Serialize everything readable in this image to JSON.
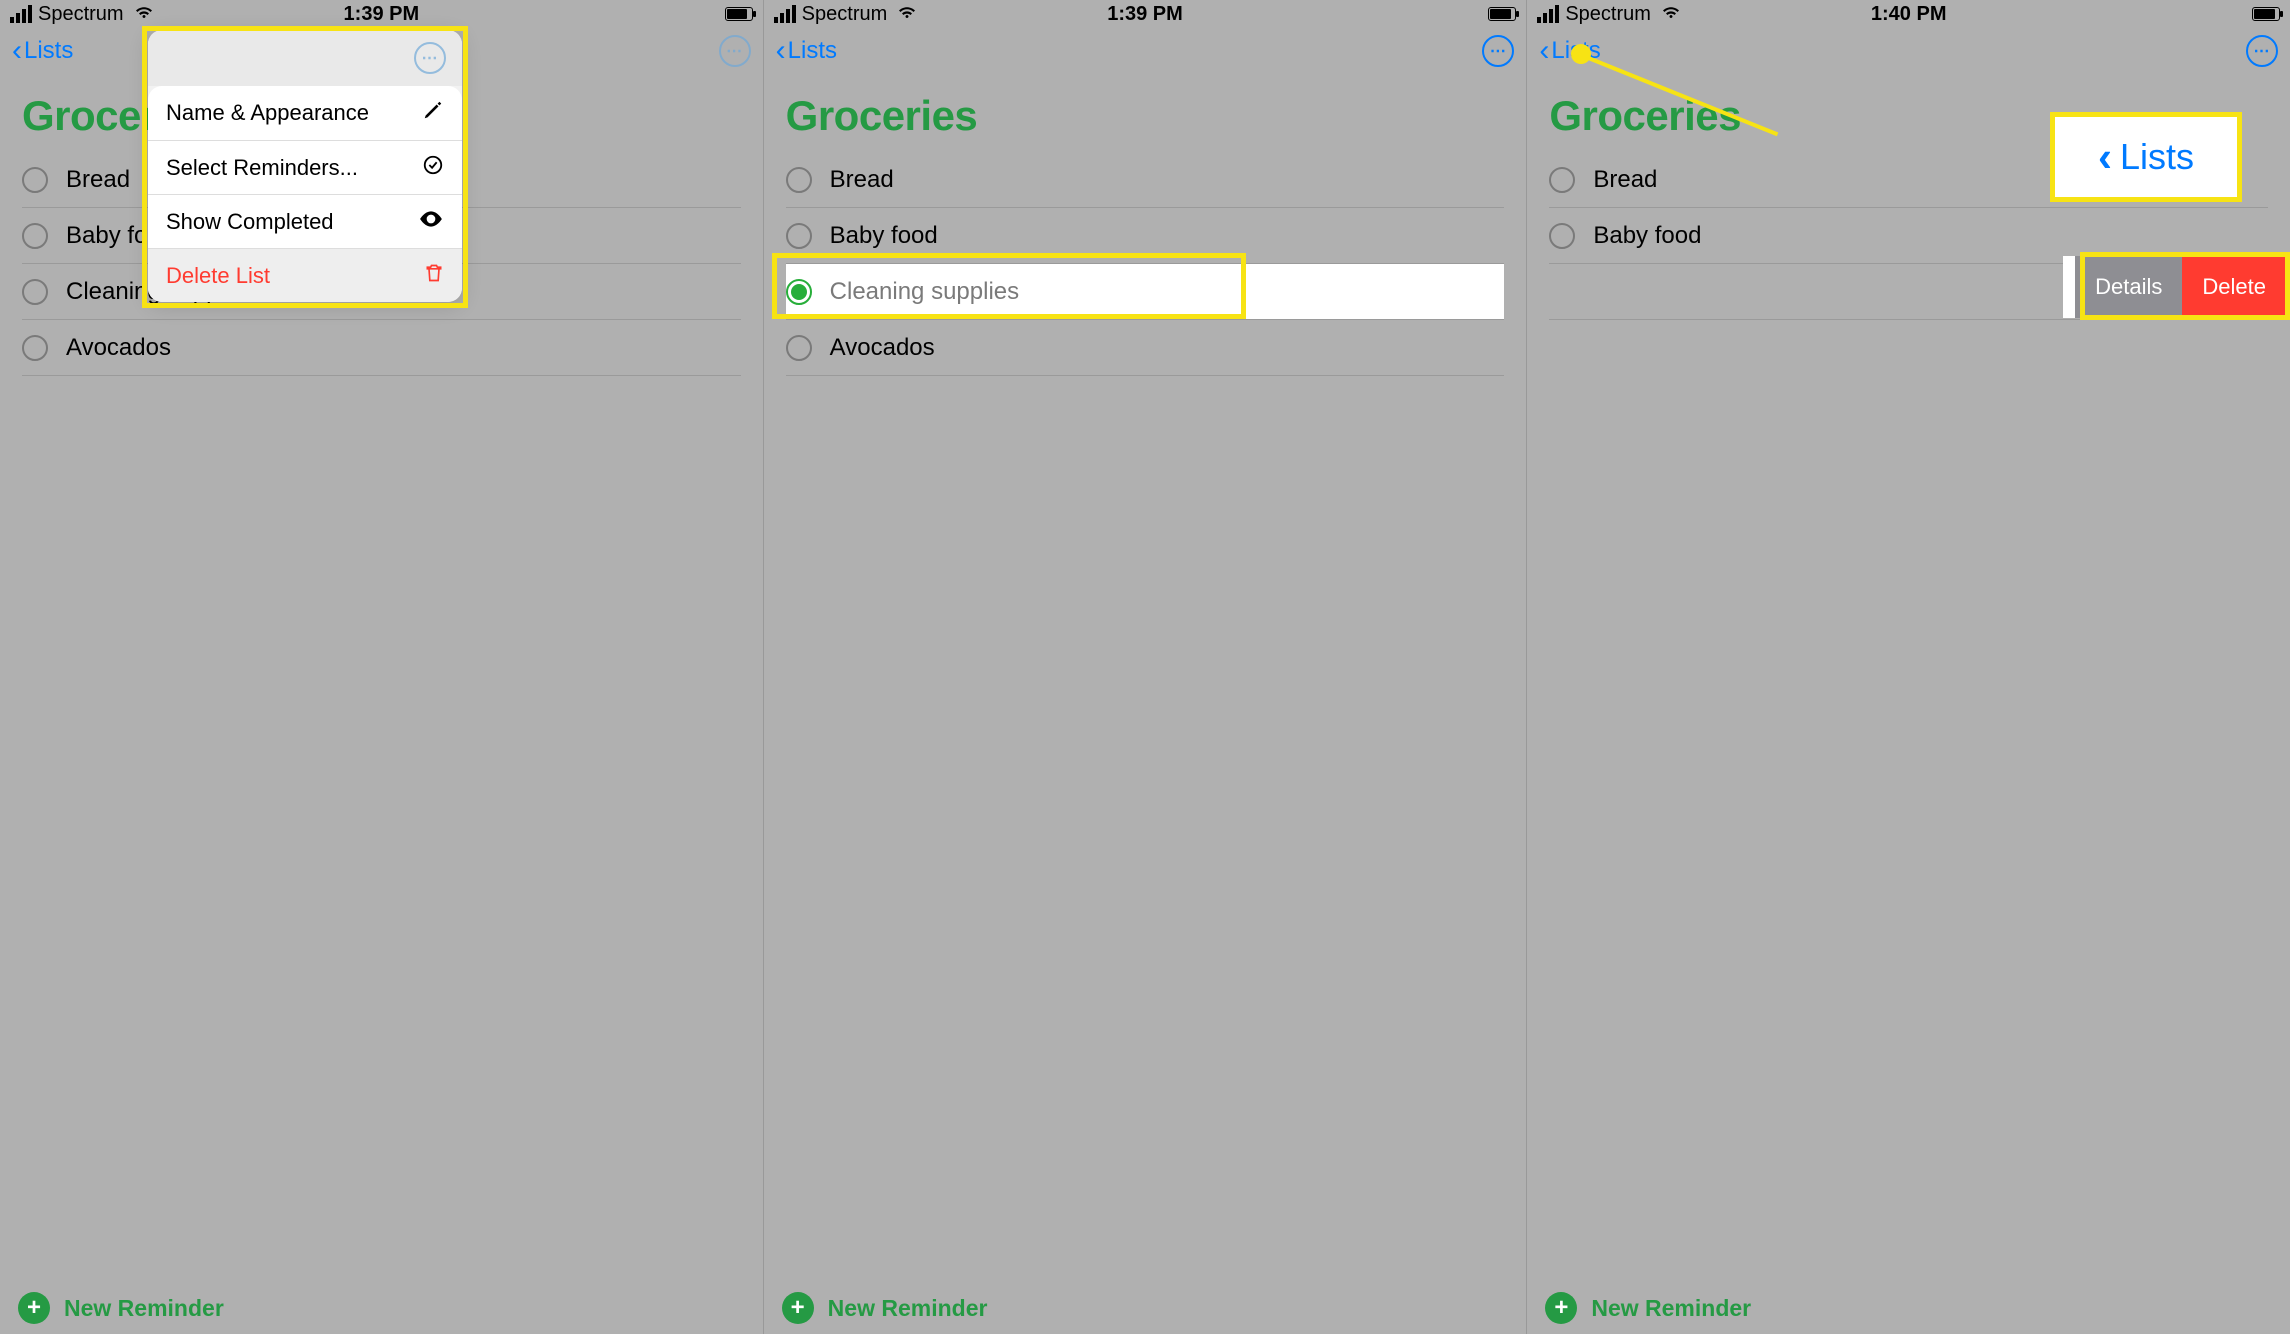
{
  "screens": [
    {
      "status": {
        "carrier": "Spectrum",
        "time": "1:39 PM"
      },
      "back_label": "Lists",
      "title": "Groceries",
      "items": [
        {
          "label": "Bread",
          "checked": false
        },
        {
          "label": "Baby food",
          "checked": false
        },
        {
          "label": "Cleaning supplies",
          "checked": false
        },
        {
          "label": "Avocados",
          "checked": false
        }
      ],
      "new_reminder": "New Reminder",
      "popover": {
        "rows": [
          {
            "label": "Name & Appearance",
            "icon": "pencil"
          },
          {
            "label": "Select Reminders...",
            "icon": "check-circle"
          },
          {
            "label": "Show Completed",
            "icon": "eye"
          },
          {
            "label": "Delete List",
            "icon": "trash",
            "danger": true
          }
        ]
      }
    },
    {
      "status": {
        "carrier": "Spectrum",
        "time": "1:39 PM"
      },
      "back_label": "Lists",
      "title": "Groceries",
      "items": [
        {
          "label": "Bread",
          "checked": false
        },
        {
          "label": "Baby food",
          "checked": false
        },
        {
          "label": "Cleaning supplies",
          "checked": true
        },
        {
          "label": "Avocados",
          "checked": false
        }
      ],
      "new_reminder": "New Reminder"
    },
    {
      "status": {
        "carrier": "Spectrum",
        "time": "1:40 PM"
      },
      "back_label": "Lists",
      "title": "Groceries",
      "items": [
        {
          "label": "Bread",
          "checked": false
        },
        {
          "label": "Baby food",
          "checked": false
        }
      ],
      "new_reminder": "New Reminder",
      "swipe": {
        "details": "Details",
        "delete": "Delete"
      },
      "callout_label": "Lists"
    }
  ]
}
